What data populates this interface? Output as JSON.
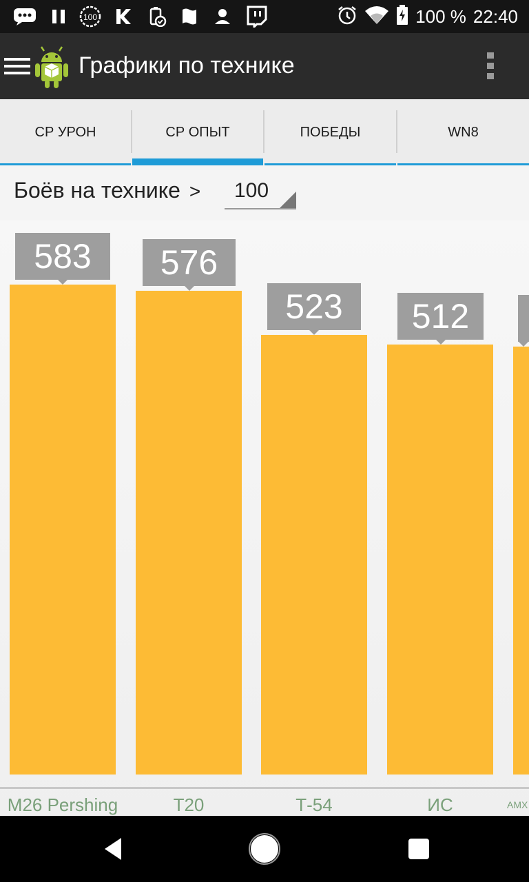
{
  "status_bar": {
    "battery_text": "100 %",
    "time": "22:40",
    "left_icons": [
      "messenger-icon",
      "pause-icon",
      "badge-100-icon",
      "k-icon",
      "cleaner-icon",
      "file-icon",
      "person-icon",
      "twitch-icon"
    ],
    "right_icons": [
      "alarm-icon",
      "wifi-icon",
      "battery-icon"
    ]
  },
  "app_bar": {
    "title": "Графики по технике",
    "menu_icon": "hamburger-icon",
    "logo_icon": "android-logo-icon",
    "overflow_icon": "overflow-menu-icon"
  },
  "tabs": [
    {
      "label": "СР УРОН",
      "active": false
    },
    {
      "label": "СР ОПЫТ",
      "active": true
    },
    {
      "label": "ПОБЕДЫ",
      "active": false
    },
    {
      "label": "WN8",
      "active": false
    }
  ],
  "filter": {
    "label": "Боёв на технике",
    "chevron": ">",
    "value": "100"
  },
  "colors": {
    "bar": "#fdbb35",
    "value_tag": "#9e9e9e",
    "accent": "#1e9bd7",
    "label_green": "#7aa07a"
  },
  "chart_data": {
    "type": "bar",
    "categories": [
      "M26 Pershing",
      "T20",
      "Т-54",
      "ИС",
      "AMX"
    ],
    "values": [
      583,
      576,
      523,
      512,
      null
    ],
    "value_labels": [
      "583",
      "576",
      "523",
      "512",
      ""
    ],
    "title": "",
    "xlabel": "",
    "ylabel": ""
  },
  "nav_bar": {
    "back_icon": "back-triangle-icon",
    "home_icon": "home-circle-icon",
    "recents_icon": "recents-square-icon"
  }
}
